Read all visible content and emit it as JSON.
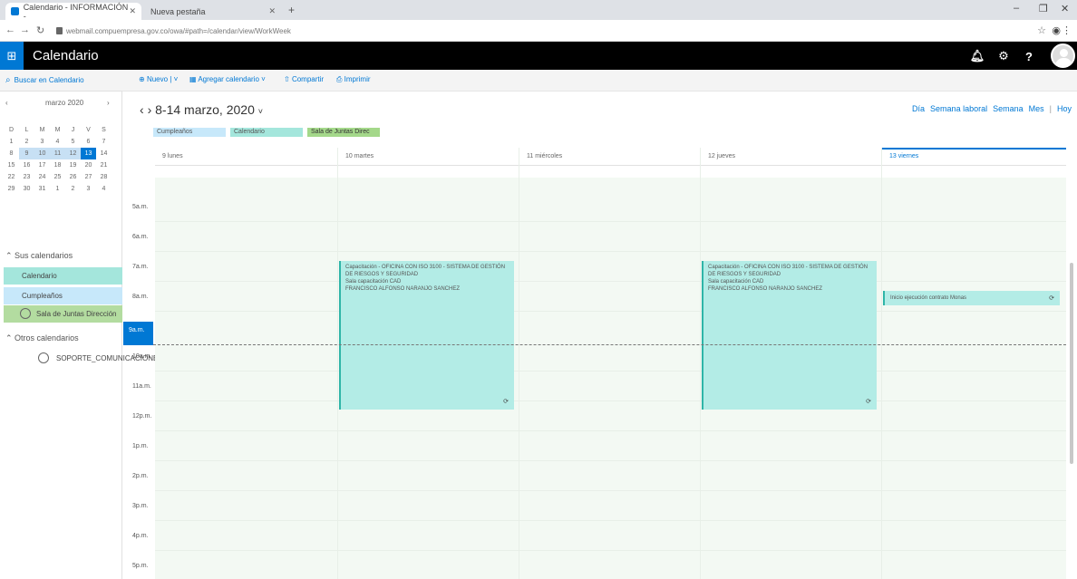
{
  "browser": {
    "tabs": [
      {
        "title": "Calendario - INFORMACIÓN -",
        "active": true
      },
      {
        "title": "Nueva pestaña",
        "active": false
      }
    ],
    "url": "webmail.compuempresa.gov.co/owa/#path=/calendar/view/WorkWeek",
    "controls": {
      "minimize": "–",
      "maximize": "❐",
      "close": "✕"
    }
  },
  "app": {
    "title": "Calendario",
    "header_icons": {
      "bell": "bell-icon",
      "settings": "gear-icon",
      "help": "?"
    }
  },
  "left": {
    "search_label": "Buscar en Calendario",
    "mini_cal": {
      "month": "marzo 2020",
      "prev": "‹",
      "next": "›",
      "weekday_header": [
        "D",
        "L",
        "M",
        "M",
        "J",
        "V",
        "S"
      ],
      "rows": [
        [
          "1",
          "2",
          "3",
          "4",
          "5",
          "6",
          "7"
        ],
        [
          "8",
          "9",
          "10",
          "11",
          "12",
          "13",
          "14"
        ],
        [
          "15",
          "16",
          "17",
          "18",
          "19",
          "20",
          "21"
        ],
        [
          "22",
          "23",
          "24",
          "25",
          "26",
          "27",
          "28"
        ],
        [
          "29",
          "30",
          "31",
          "1",
          "2",
          "3",
          "4"
        ]
      ],
      "today": "13"
    },
    "my_calendars_label": "Sus calendarios",
    "calendars": [
      {
        "name": "Calendario"
      },
      {
        "name": "Cumpleaños"
      },
      {
        "name": "Sala de Juntas Dirección"
      }
    ],
    "other_calendars_label": "Otros calendarios",
    "other_calendars": [
      {
        "name": "SOPORTE_COMUNICACIONES"
      }
    ]
  },
  "toolbar": {
    "new_label": "Nuevo",
    "add_calendar_label": "Agregar calendario",
    "share_label": "Compartir",
    "print_label": "Imprimir"
  },
  "main": {
    "date_range": "8-14 marzo, 2020",
    "views": [
      "Día",
      "Semana laboral",
      "Semana",
      "Mes",
      "Hoy"
    ],
    "current_view": "Semana laboral",
    "chips": [
      "Cumpleaños",
      "Calendario",
      "Sala de Juntas Direc"
    ],
    "days": [
      "9 lunes",
      "10 martes",
      "11 miércoles",
      "12 jueves",
      "13 viernes"
    ],
    "times": [
      "5a.m.",
      "6a.m.",
      "7a.m.",
      "8a.m.",
      "9a.m.",
      "10a.m.",
      "11a.m.",
      "12p.m.",
      "1p.m.",
      "2p.m.",
      "3p.m.",
      "4p.m.",
      "5p.m."
    ],
    "now_label": "9a.m.",
    "events": [
      {
        "title": "Capacitación - OFICINA CON ISO 3100 - SISTEMA DE GESTIÓN DE RIESGOS Y SEGURIDAD",
        "location": "Sala capacitación CAD",
        "organizer": "FRANCISCO ALFONSO NARANJO SANCHEZ",
        "recurring": "⟳"
      },
      {
        "title": "Capacitación - OFICINA CON ISO 3100 - SISTEMA DE GESTIÓN DE RIESGOS Y SEGURIDAD",
        "location": "Sala capacitación CAD",
        "organizer": "FRANCISCO ALFONSO NARANJO SANCHEZ",
        "recurring": "⟳"
      },
      {
        "title": "Inicio ejecución contrato Monas",
        "recurring": "⟳"
      }
    ]
  },
  "colors": {
    "accent": "#0078d4",
    "header_bg": "#000000",
    "event_bg": "#b3ece6",
    "grid_bg": "#f3f9f3"
  }
}
